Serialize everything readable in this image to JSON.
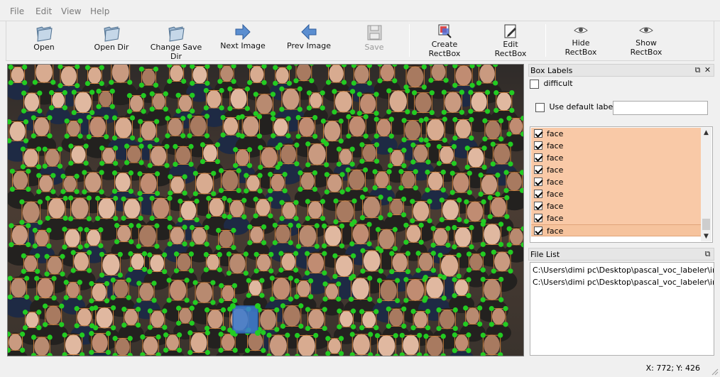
{
  "menu": [
    "File",
    "Edit",
    "View",
    "Help"
  ],
  "toolbar": {
    "open": "Open",
    "open_dir": "Open Dir",
    "change_save_dir": "Change Save Dir",
    "next_image": "Next Image",
    "prev_image": "Prev Image",
    "save": "Save",
    "create_rectbox": [
      "Create",
      "RectBox"
    ],
    "edit_rectbox": [
      "Edit",
      "RectBox"
    ],
    "hide_rectbox": [
      "Hide",
      "RectBox"
    ],
    "show_rectbox": [
      "Show",
      "RectBox"
    ]
  },
  "box_labels": {
    "title": "Box Labels",
    "difficult": "difficult",
    "use_default_label": "Use default label",
    "default_label_value": "",
    "items": [
      {
        "label": "face",
        "checked": true
      },
      {
        "label": "face",
        "checked": true
      },
      {
        "label": "face",
        "checked": true
      },
      {
        "label": "face",
        "checked": true
      },
      {
        "label": "face",
        "checked": true
      },
      {
        "label": "face",
        "checked": true
      },
      {
        "label": "face",
        "checked": true
      },
      {
        "label": "face",
        "checked": true
      },
      {
        "label": "face",
        "checked": true
      }
    ]
  },
  "file_list": {
    "title": "File List",
    "items": [
      "C:\\Users\\dimi pc\\Desktop\\pascal_voc_labeler\\in",
      "C:\\Users\\dimi pc\\Desktop\\pascal_voc_labeler\\in"
    ]
  },
  "status": {
    "coords": "X: 772; Y: 426"
  },
  "colors": {
    "accent_handle": "#22cc22",
    "box_outline": "#d2823c",
    "selected_box": "#3c7dd2",
    "label_row": "#f9c9a7"
  }
}
